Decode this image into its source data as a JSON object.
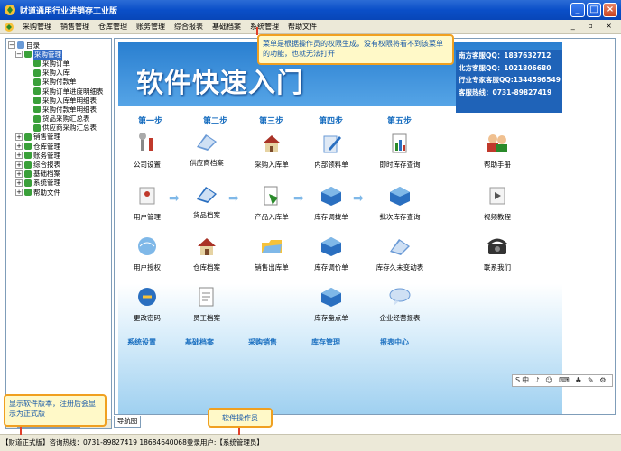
{
  "window": {
    "title": "财道通用行业进销存工业版",
    "minimize": "_",
    "restore": "□",
    "close": "×"
  },
  "menu": {
    "items": [
      "采购管理",
      "销售管理",
      "仓库管理",
      "账务管理",
      "综合报表",
      "基础档案",
      "系统管理",
      "帮助文件"
    ],
    "right_controls": "_ ▫ ×"
  },
  "tree": {
    "root": "目录",
    "nodes": [
      {
        "label": "采购管理",
        "level": 1,
        "expanded": true,
        "selected": true
      },
      {
        "label": "采购订单",
        "level": 2
      },
      {
        "label": "采购入库",
        "level": 2
      },
      {
        "label": "采购付款单",
        "level": 2
      },
      {
        "label": "采购订单进度明细表",
        "level": 2
      },
      {
        "label": "采购入库单明细表",
        "level": 2
      },
      {
        "label": "采购付款单明细表",
        "level": 2
      },
      {
        "label": "货品采购汇总表",
        "level": 2
      },
      {
        "label": "供应商采购汇总表",
        "level": 2
      },
      {
        "label": "销售管理",
        "level": 1
      },
      {
        "label": "仓库管理",
        "level": 1
      },
      {
        "label": "账务管理",
        "level": 1
      },
      {
        "label": "综合报表",
        "level": 1
      },
      {
        "label": "基础档案",
        "level": 1
      },
      {
        "label": "系统管理",
        "level": 1
      },
      {
        "label": "帮助文件",
        "level": 1
      }
    ]
  },
  "banner": {
    "logo": "软件快速入门",
    "contacts": [
      "南方客服QQ：1837632712",
      "北方客服QQ：1021806680",
      "行业专家客服QQ:1344596549",
      "客服热线：0731-89827419"
    ]
  },
  "steps": [
    "第一步",
    "第二步",
    "第三步",
    "第四步",
    "第五步"
  ],
  "features": {
    "company": "公司设置",
    "supplier": "供应商档案",
    "purchase_in": "采购入库单",
    "internal_use": "内部领料单",
    "realtime_stock": "即时库存查询",
    "help_manual": "帮助手册",
    "user_mgmt": "用户管理",
    "goods": "货品档案",
    "product_in": "产品入库单",
    "transfer": "库存调拨单",
    "batch_query": "批次库存查询",
    "video": "视频教程",
    "user_auth": "用户授权",
    "warehouse": "仓库档案",
    "sales_out": "销售出库单",
    "stock_price": "库存调价单",
    "stagnant": "库存久未变动表",
    "contact_us": "联系我们",
    "change_pwd": "更改密码",
    "staff": "员工档案",
    "stocktake": "库存盘点单",
    "ops_report": "企业经营报表"
  },
  "bottom_tabs": [
    "系统设置",
    "基础档案",
    "采购销售",
    "库存管理",
    "报表中心"
  ],
  "ime": "S中 ♪ ☺ ⌨ ♣ ✎ ⚙",
  "nav_tab": "导航图",
  "status": "【财道正式版】咨询热线：0731-89827419 18684640068登录用户:【系统管理员】",
  "callouts": {
    "menu_note": "菜单是根据操作员的权限生成，没有权限将看不到该菜单的功能，也就无法打开",
    "version_note": "显示软件版本，注册后会显示为正式版",
    "operator_note": "软件操作员"
  },
  "colors": {
    "titlebar": "#0a4fc8",
    "accent_blue": "#1a6fc0",
    "callout_border": "#f0a020",
    "selection": "#316ac5"
  }
}
